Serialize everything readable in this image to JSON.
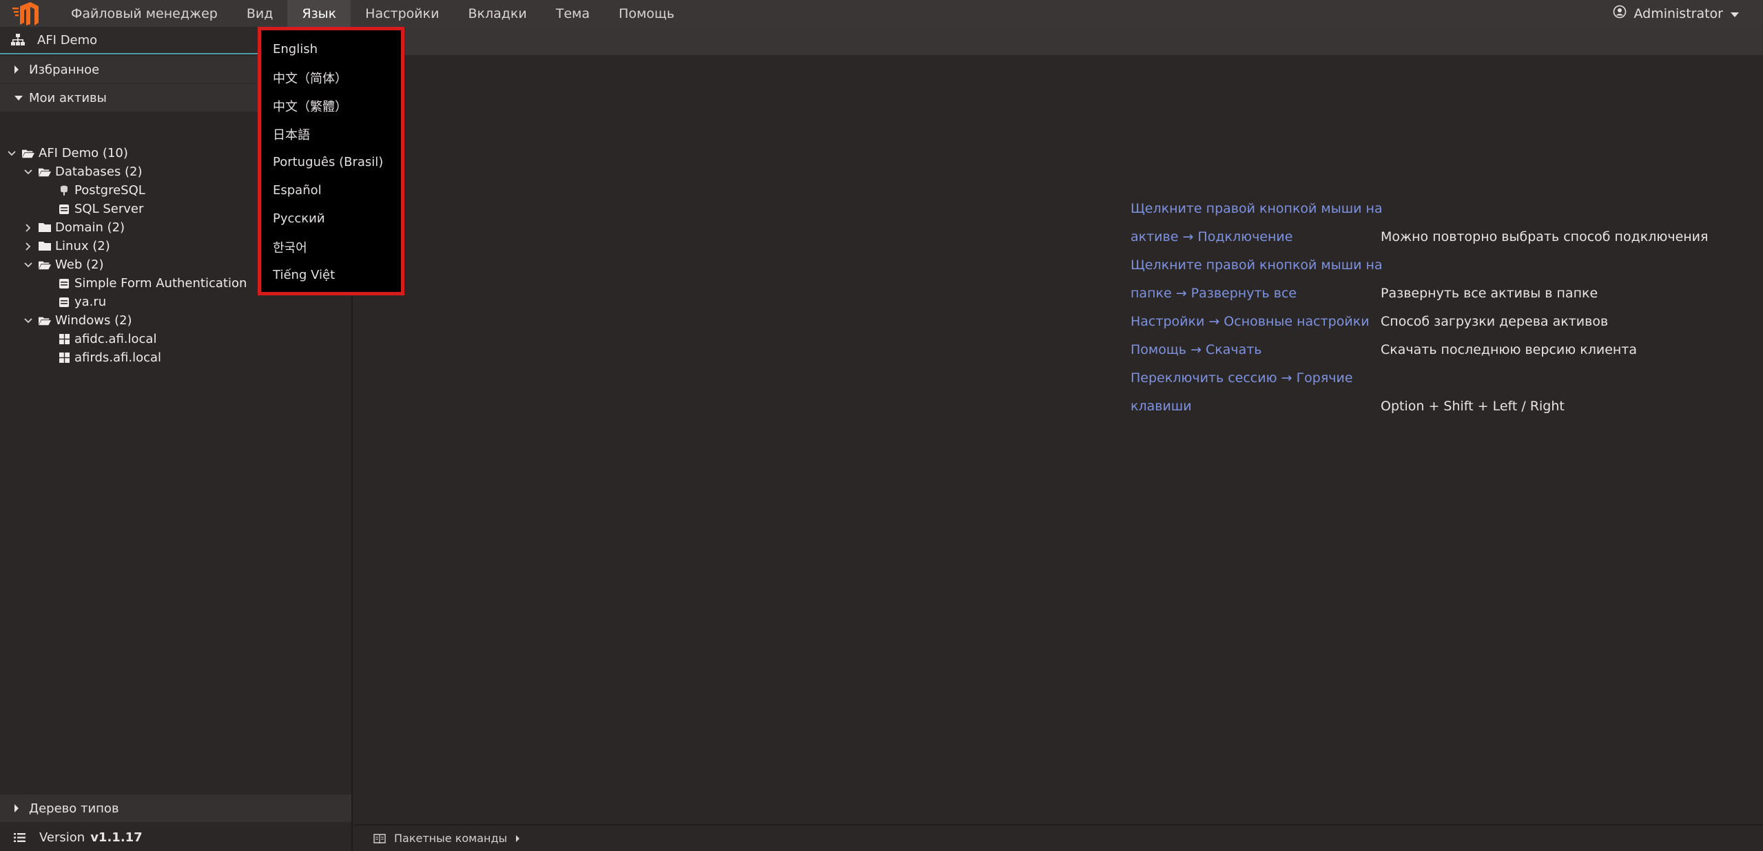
{
  "menubar": {
    "items": [
      "Файловый менеджер",
      "Вид",
      "Язык",
      "Настройки",
      "Вкладки",
      "Тема",
      "Помощь"
    ],
    "active_index": 2,
    "user": "Administrator"
  },
  "language_menu": {
    "items": [
      "English",
      "中文（简体）",
      "中文（繁體）",
      "日本語",
      "Português (Brasil)",
      "Español",
      "Русский",
      "한국어",
      "Tiếng Việt"
    ]
  },
  "sidebar": {
    "project": "AFI Demo",
    "favorites": "Избранное",
    "my_assets": "Мои активы",
    "tree": [
      {
        "label": "AFI Demo (10)",
        "icon": "folder-open-icon",
        "chevron": "down"
      },
      {
        "label": "Databases (2)",
        "icon": "folder-open-icon",
        "chevron": "down"
      },
      {
        "label": "PostgreSQL",
        "icon": "postgresql-icon",
        "chevron": ""
      },
      {
        "label": "SQL Server",
        "icon": "sql-server-icon",
        "chevron": ""
      },
      {
        "label": "Domain (2)",
        "icon": "folder-icon",
        "chevron": "right"
      },
      {
        "label": "Linux (2)",
        "icon": "folder-icon",
        "chevron": "right"
      },
      {
        "label": "Web (2)",
        "icon": "folder-open-icon",
        "chevron": "down"
      },
      {
        "label": "Simple Form Authentication",
        "icon": "web-icon",
        "chevron": ""
      },
      {
        "label": "ya.ru",
        "icon": "web-icon",
        "chevron": ""
      },
      {
        "label": "Windows (2)",
        "icon": "folder-open-icon",
        "chevron": "down"
      },
      {
        "label": "afidc.afi.local",
        "icon": "windows-icon",
        "chevron": ""
      },
      {
        "label": "afirds.afi.local",
        "icon": "windows-icon",
        "chevron": ""
      }
    ],
    "type_tree": "Дерево типов",
    "version_label": "Version",
    "version_value": "v1.1.17"
  },
  "tips": [
    {
      "left": [
        "Щелкните правой кнопкой мыши на",
        "активе → Подключение"
      ],
      "right": "Можно повторно выбрать способ подключения"
    },
    {
      "left": [
        "Щелкните правой кнопкой мыши на",
        "папке → Развернуть все"
      ],
      "right": "Развернуть все активы в папке"
    },
    {
      "left": [
        "Настройки → Основные настройки"
      ],
      "right": "Способ загрузки дерева активов"
    },
    {
      "left": [
        "Помощь → Скачать"
      ],
      "right": "Скачать последнюю версию клиента"
    },
    {
      "left": [
        "Переключить сессию → Горячие",
        "клавиши"
      ],
      "right": "Option + Shift + Left / Right"
    }
  ],
  "bottombar": {
    "batch_commands": "Пакетные команды"
  },
  "colors": {
    "accent": "#4d9ba8",
    "link": "#7d92e0",
    "highlight_border": "#d51c1c",
    "logo": "#f26b1d"
  }
}
